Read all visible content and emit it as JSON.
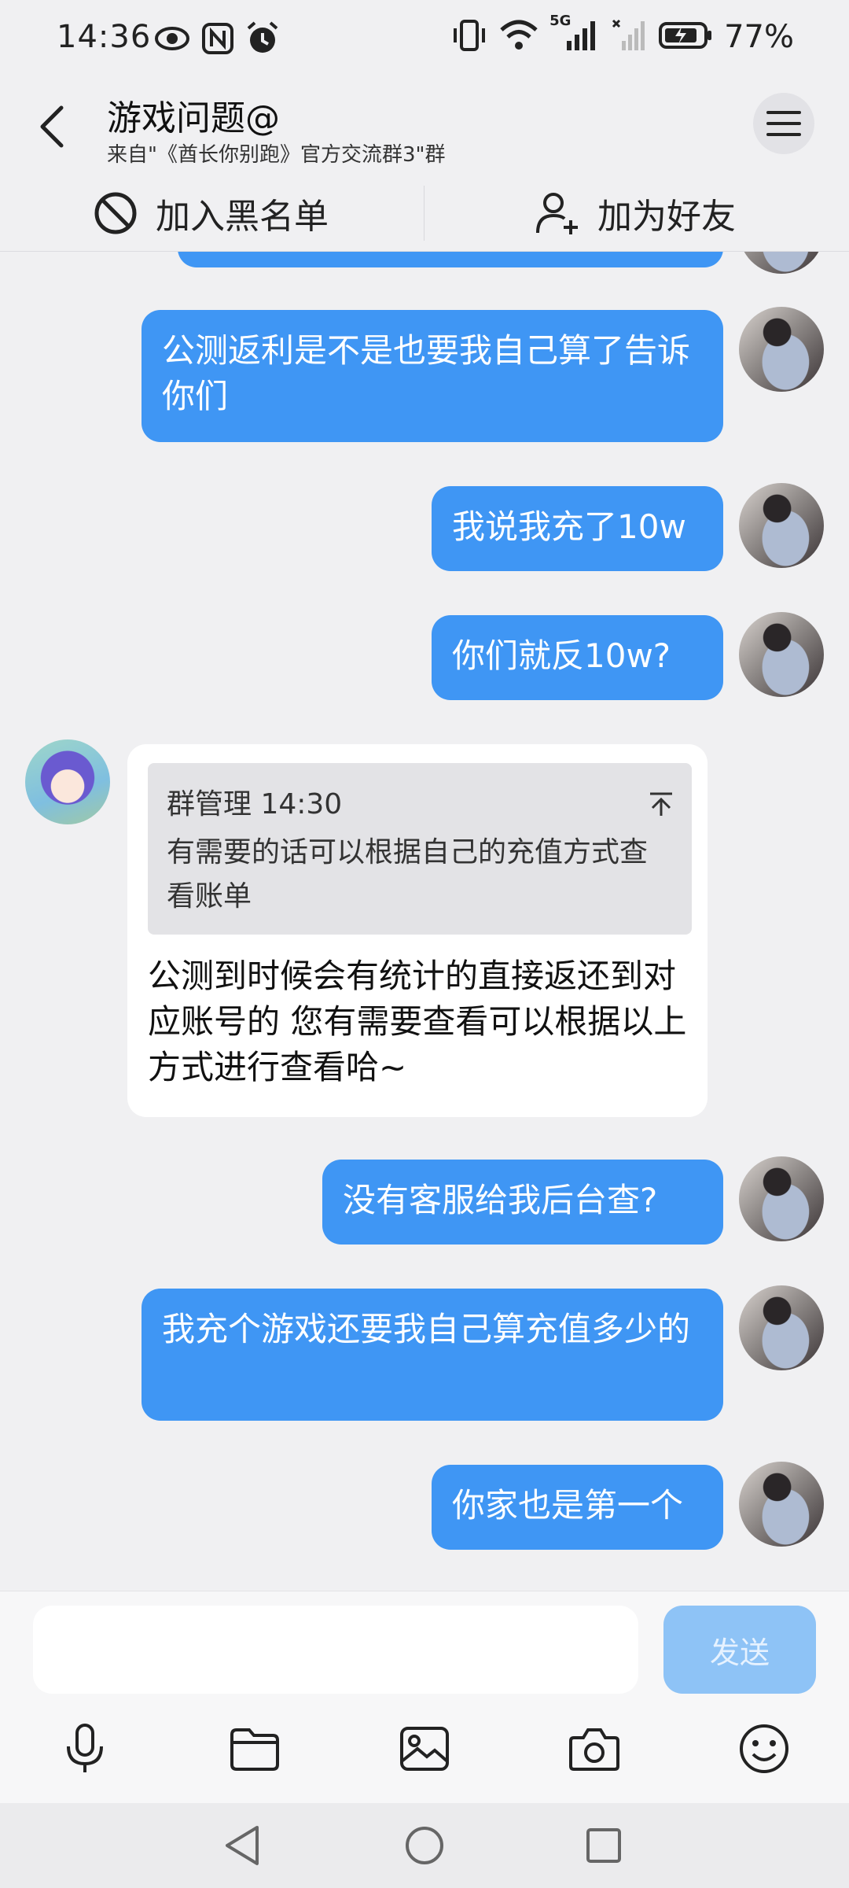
{
  "status_bar": {
    "time": "14:36",
    "battery": "77%",
    "network": "5G",
    "icons_left": [
      "eye-icon",
      "nfc-icon",
      "alarm-icon"
    ],
    "icons_right": [
      "vibrate-icon",
      "wifi-icon",
      "signal-icon",
      "signal-icon-2",
      "battery-icon"
    ]
  },
  "header": {
    "title": "游戏问题@",
    "subtitle": "来自\"《酋长你别跑》官方交流群3\"群"
  },
  "actions": {
    "blacklist": "加入黑名单",
    "add_friend": "加为好友"
  },
  "messages": {
    "m1": "公测返利是不是也要我自己算了告诉你们",
    "m2": "我说我充了10w",
    "m3": "你们就反10w?",
    "admin_reply": {
      "quote_sender": "群管理 14:30",
      "quote_text": "有需要的话可以根据自己的充值方式查看账单",
      "text": "公测到时候会有统计的直接返还到对应账号的 您有需要查看可以根据以上方式进行查看哈~"
    },
    "m5": "没有客服给我后台查?",
    "m6": "我充个游戏还要我自己算充值多少的",
    "m7": "你家也是第一个"
  },
  "input": {
    "placeholder": "",
    "send_label": "发送"
  },
  "colors": {
    "outgoing_bubble": "#3f96f4",
    "send_button_disabled": "#8ec3f6",
    "background": "#f0f0f2"
  }
}
